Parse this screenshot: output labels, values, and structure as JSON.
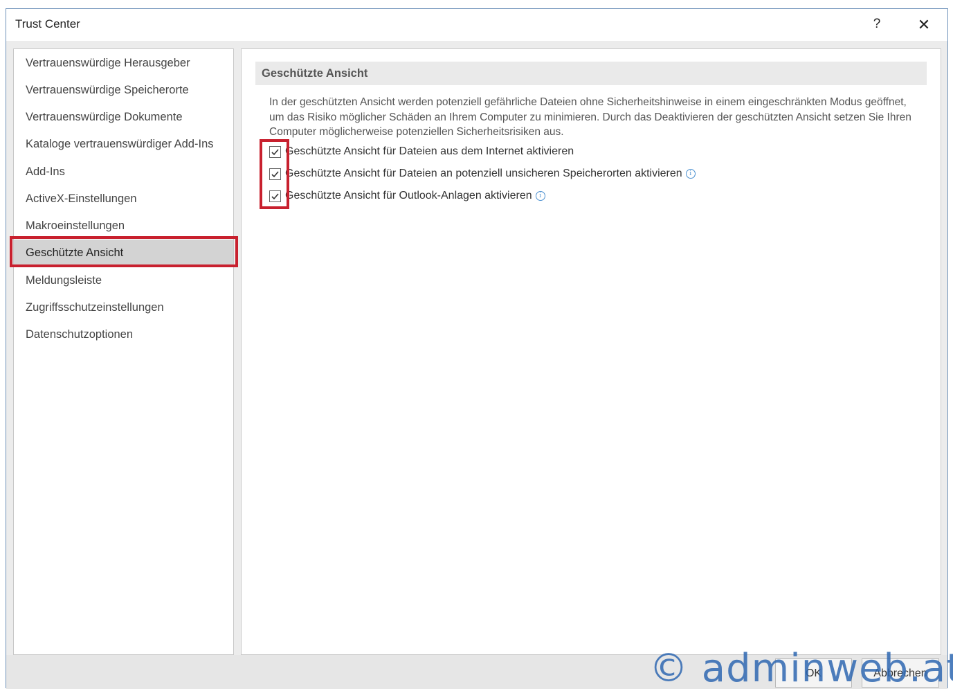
{
  "window": {
    "title": "Trust Center",
    "help_label": "?",
    "close_label": "✕"
  },
  "sidebar": {
    "items": [
      {
        "label": "Vertrauenswürdige Herausgeber"
      },
      {
        "label": "Vertrauenswürdige Speicherorte"
      },
      {
        "label": "Vertrauenswürdige Dokumente"
      },
      {
        "label": "Kataloge vertrauenswürdiger Add-Ins"
      },
      {
        "label": "Add-Ins"
      },
      {
        "label": "ActiveX-Einstellungen"
      },
      {
        "label": "Makroeinstellungen"
      },
      {
        "label": "Geschützte Ansicht",
        "selected": true
      },
      {
        "label": "Meldungsleiste"
      },
      {
        "label": "Zugriffsschutzeinstellungen"
      },
      {
        "label": "Datenschutzoptionen"
      }
    ]
  },
  "content": {
    "section_title": "Geschützte Ansicht",
    "description": "In der geschützten Ansicht werden potenziell gefährliche Dateien ohne Sicherheitshinweise in einem eingeschränkten Modus geöffnet, um das Risiko möglicher Schäden an Ihrem Computer zu minimieren. Durch das Deaktivieren der geschützten Ansicht setzen Sie Ihren Computer möglicherweise potenziellen Sicherheitsrisiken aus.",
    "options": [
      {
        "label": "Geschützte Ansicht für Dateien aus dem Internet aktivieren",
        "checked": true,
        "info": false
      },
      {
        "label": "Geschützte Ansicht für Dateien an potenziell unsicheren Speicherorten aktivieren",
        "checked": true,
        "info": true
      },
      {
        "label": "Geschützte Ansicht für Outlook-Anlagen aktivieren",
        "checked": true,
        "info": true
      }
    ]
  },
  "footer": {
    "ok_label": "OK",
    "cancel_label": "Abbrechen"
  },
  "watermark": {
    "text": "© adminweb.at"
  },
  "colors": {
    "highlight": "#c8202e",
    "selected_bg": "#d3d3d3"
  }
}
